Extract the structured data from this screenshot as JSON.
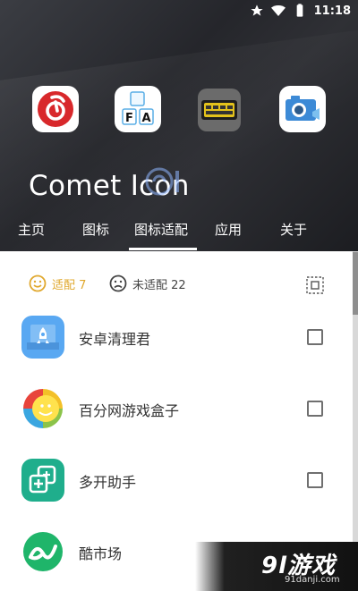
{
  "status_bar": {
    "time": "11:18",
    "icons": [
      "star-icon",
      "wifi-icon",
      "battery-icon"
    ]
  },
  "header": {
    "app_title": "Comet Icon",
    "featured_icons": [
      "netease-music-icon",
      "fa-keyboard-icon",
      "keyboard-keys-icon",
      "camera-app-icon"
    ]
  },
  "tabs": {
    "items": [
      {
        "label": "主页"
      },
      {
        "label": "图标"
      },
      {
        "label": "图标适配",
        "active": true
      },
      {
        "label": "应用"
      },
      {
        "label": "关于"
      }
    ]
  },
  "filter": {
    "matched_label": "适配 7",
    "unmatched_label": "未适配 22",
    "matched_color": "#e0a82e"
  },
  "apps": [
    {
      "name": "安卓清理君",
      "icon": "rocket-cleaner-icon",
      "checked": false
    },
    {
      "name": "百分网游戏盒子",
      "icon": "smiley-game-box-icon",
      "checked": false
    },
    {
      "name": "多开助手",
      "icon": "multi-open-plus-icon",
      "checked": false
    },
    {
      "name": "酷市场",
      "icon": "coolmarket-icon",
      "checked": false
    }
  ],
  "watermark": {
    "text": "9l游戏",
    "url": "91danji.com"
  }
}
